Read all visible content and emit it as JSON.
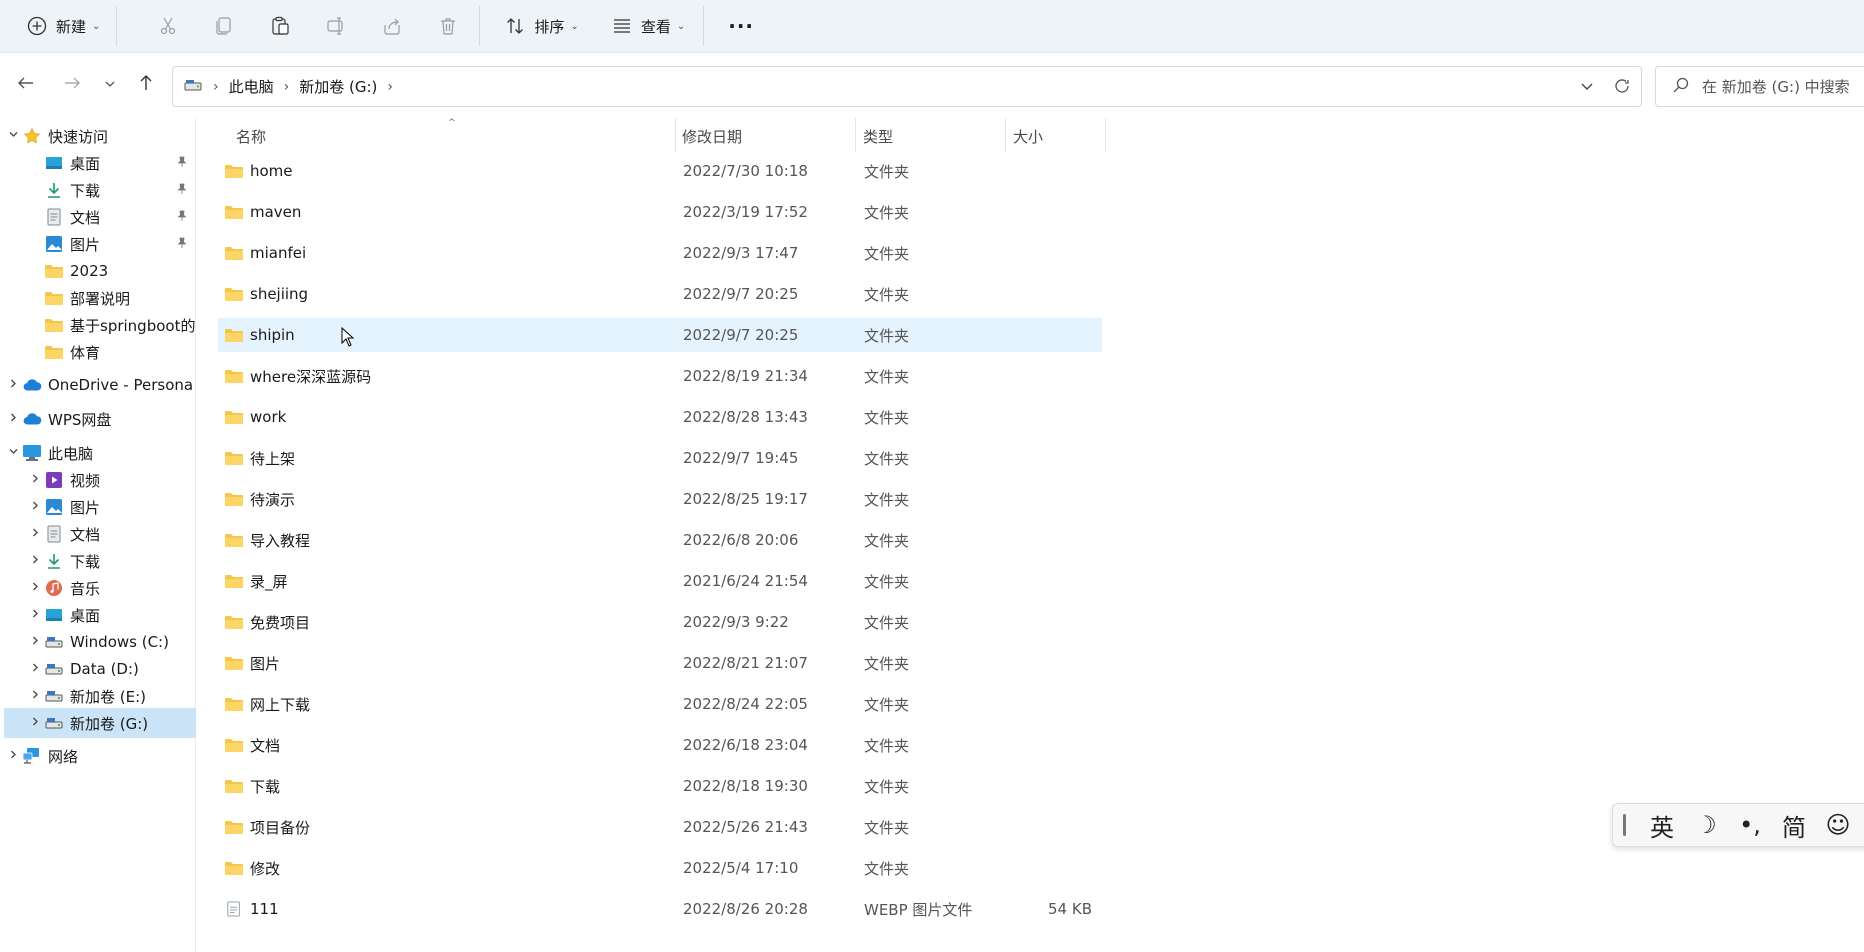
{
  "toolbar": {
    "new_label": "新建",
    "sort_label": "排序",
    "view_label": "查看",
    "more_label": "···"
  },
  "address": {
    "crumbs": [
      "此电脑",
      "新加卷 (G:)"
    ]
  },
  "search": {
    "placeholder": "在 新加卷 (G:) 中搜索"
  },
  "sidebar": {
    "items": [
      {
        "label": "快速访问",
        "icon": "star-icon"
      },
      {
        "label": "桌面",
        "icon": "desktop-icon"
      },
      {
        "label": "下载",
        "icon": "download-icon"
      },
      {
        "label": "文档",
        "icon": "document-icon"
      },
      {
        "label": "图片",
        "icon": "pictures-icon"
      },
      {
        "label": "2023",
        "icon": "folder-icon"
      },
      {
        "label": "部署说明",
        "icon": "folder-icon"
      },
      {
        "label": "基于springboot的",
        "icon": "folder-icon"
      },
      {
        "label": "体育",
        "icon": "folder-icon"
      },
      {
        "label": "OneDrive - Persona",
        "icon": "cloud-icon"
      },
      {
        "label": "WPS网盘",
        "icon": "cloud-icon"
      },
      {
        "label": "此电脑",
        "icon": "computer-icon"
      },
      {
        "label": "视频",
        "icon": "video-icon"
      },
      {
        "label": "图片",
        "icon": "pictures-icon"
      },
      {
        "label": "文档",
        "icon": "document-icon"
      },
      {
        "label": "下载",
        "icon": "download-icon"
      },
      {
        "label": "音乐",
        "icon": "music-icon"
      },
      {
        "label": "桌面",
        "icon": "desktop-icon"
      },
      {
        "label": "Windows (C:)",
        "icon": "drive-icon"
      },
      {
        "label": "Data (D:)",
        "icon": "drive-icon"
      },
      {
        "label": "新加卷 (E:)",
        "icon": "drive-icon"
      },
      {
        "label": "新加卷 (G:)",
        "icon": "drive-icon"
      },
      {
        "label": "网络",
        "icon": "network-icon"
      }
    ]
  },
  "columns": {
    "name": "名称",
    "date": "修改日期",
    "type": "类型",
    "size": "大小"
  },
  "files": [
    {
      "name": "home",
      "date": "2022/7/30 10:18",
      "type": "文件夹",
      "size": ""
    },
    {
      "name": "maven",
      "date": "2022/3/19 17:52",
      "type": "文件夹",
      "size": ""
    },
    {
      "name": "mianfei",
      "date": "2022/9/3 17:47",
      "type": "文件夹",
      "size": ""
    },
    {
      "name": "shejiing",
      "date": "2022/9/7 20:25",
      "type": "文件夹",
      "size": ""
    },
    {
      "name": "shipin",
      "date": "2022/9/7 20:25",
      "type": "文件夹",
      "size": ""
    },
    {
      "name": "where深深蓝源码",
      "date": "2022/8/19 21:34",
      "type": "文件夹",
      "size": ""
    },
    {
      "name": "work",
      "date": "2022/8/28 13:43",
      "type": "文件夹",
      "size": ""
    },
    {
      "name": "待上架",
      "date": "2022/9/7 19:45",
      "type": "文件夹",
      "size": ""
    },
    {
      "name": "待演示",
      "date": "2022/8/25 19:17",
      "type": "文件夹",
      "size": ""
    },
    {
      "name": "导入教程",
      "date": "2022/6/8 20:06",
      "type": "文件夹",
      "size": ""
    },
    {
      "name": "录_屏",
      "date": "2021/6/24 21:54",
      "type": "文件夹",
      "size": ""
    },
    {
      "name": "免费项目",
      "date": "2022/9/3 9:22",
      "type": "文件夹",
      "size": ""
    },
    {
      "name": "图片",
      "date": "2022/8/21 21:07",
      "type": "文件夹",
      "size": ""
    },
    {
      "name": "网上下载",
      "date": "2022/8/24 22:05",
      "type": "文件夹",
      "size": ""
    },
    {
      "name": "文档",
      "date": "2022/6/18 23:04",
      "type": "文件夹",
      "size": ""
    },
    {
      "name": "下载",
      "date": "2022/8/18 19:30",
      "type": "文件夹",
      "size": ""
    },
    {
      "name": "项目备份",
      "date": "2022/5/26 21:43",
      "type": "文件夹",
      "size": ""
    },
    {
      "name": "修改",
      "date": "2022/5/4 17:10",
      "type": "文件夹",
      "size": ""
    },
    {
      "name": "111",
      "date": "2022/8/26 20:28",
      "type": "WEBP 图片文件",
      "size": "54 KB"
    }
  ],
  "ime": {
    "keys": [
      "英",
      "☽",
      "•,",
      "简",
      "☺"
    ]
  },
  "colors": {
    "toolbar_bg": "#eef3f8",
    "selected_bg": "#cce4f7",
    "hover_bg": "#e5f3ff",
    "folder": "#f5c64a"
  }
}
